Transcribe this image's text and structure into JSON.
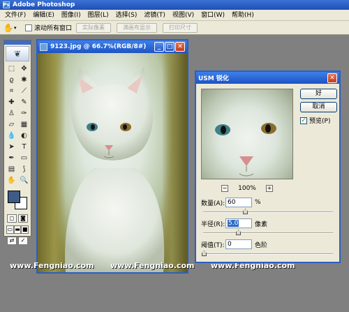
{
  "app": {
    "title": "Adobe Photoshop"
  },
  "menu": [
    {
      "label": "文件(F)"
    },
    {
      "label": "编辑(E)"
    },
    {
      "label": "图像(I)"
    },
    {
      "label": "图层(L)"
    },
    {
      "label": "选择(S)"
    },
    {
      "label": "滤镜(T)"
    },
    {
      "label": "视图(V)"
    },
    {
      "label": "窗口(W)"
    },
    {
      "label": "帮助(H)"
    }
  ],
  "options_bar": {
    "scroll_all_label": "滚动所有窗口",
    "btn_actual": "实际像素",
    "btn_fit": "满画布显示",
    "btn_print": "打印尺寸"
  },
  "colors": {
    "foreground": "#3e5c86",
    "background": "#ffffff",
    "titlebar": "#2a5fd0"
  },
  "document": {
    "title": "9123.jpg @ 66.7%(RGB/8#)"
  },
  "watermarks": [
    "www.Fengniao.com",
    "www.Fengniao.com",
    "www.Fengniao.com"
  ],
  "dialog": {
    "title": "USM 锐化",
    "ok_label": "好",
    "cancel_label": "取消",
    "preview_label": "预览(P)",
    "preview_checked": true,
    "zoom": "100%",
    "zoom_out": "−",
    "zoom_in": "+",
    "amount_label": "数量(A):",
    "amount_value": "60",
    "amount_unit": "%",
    "radius_label": "半径(R):",
    "radius_value": "5.0",
    "radius_unit": "像素",
    "threshold_label": "阈值(T):",
    "threshold_value": "0",
    "threshold_unit": "色阶"
  }
}
